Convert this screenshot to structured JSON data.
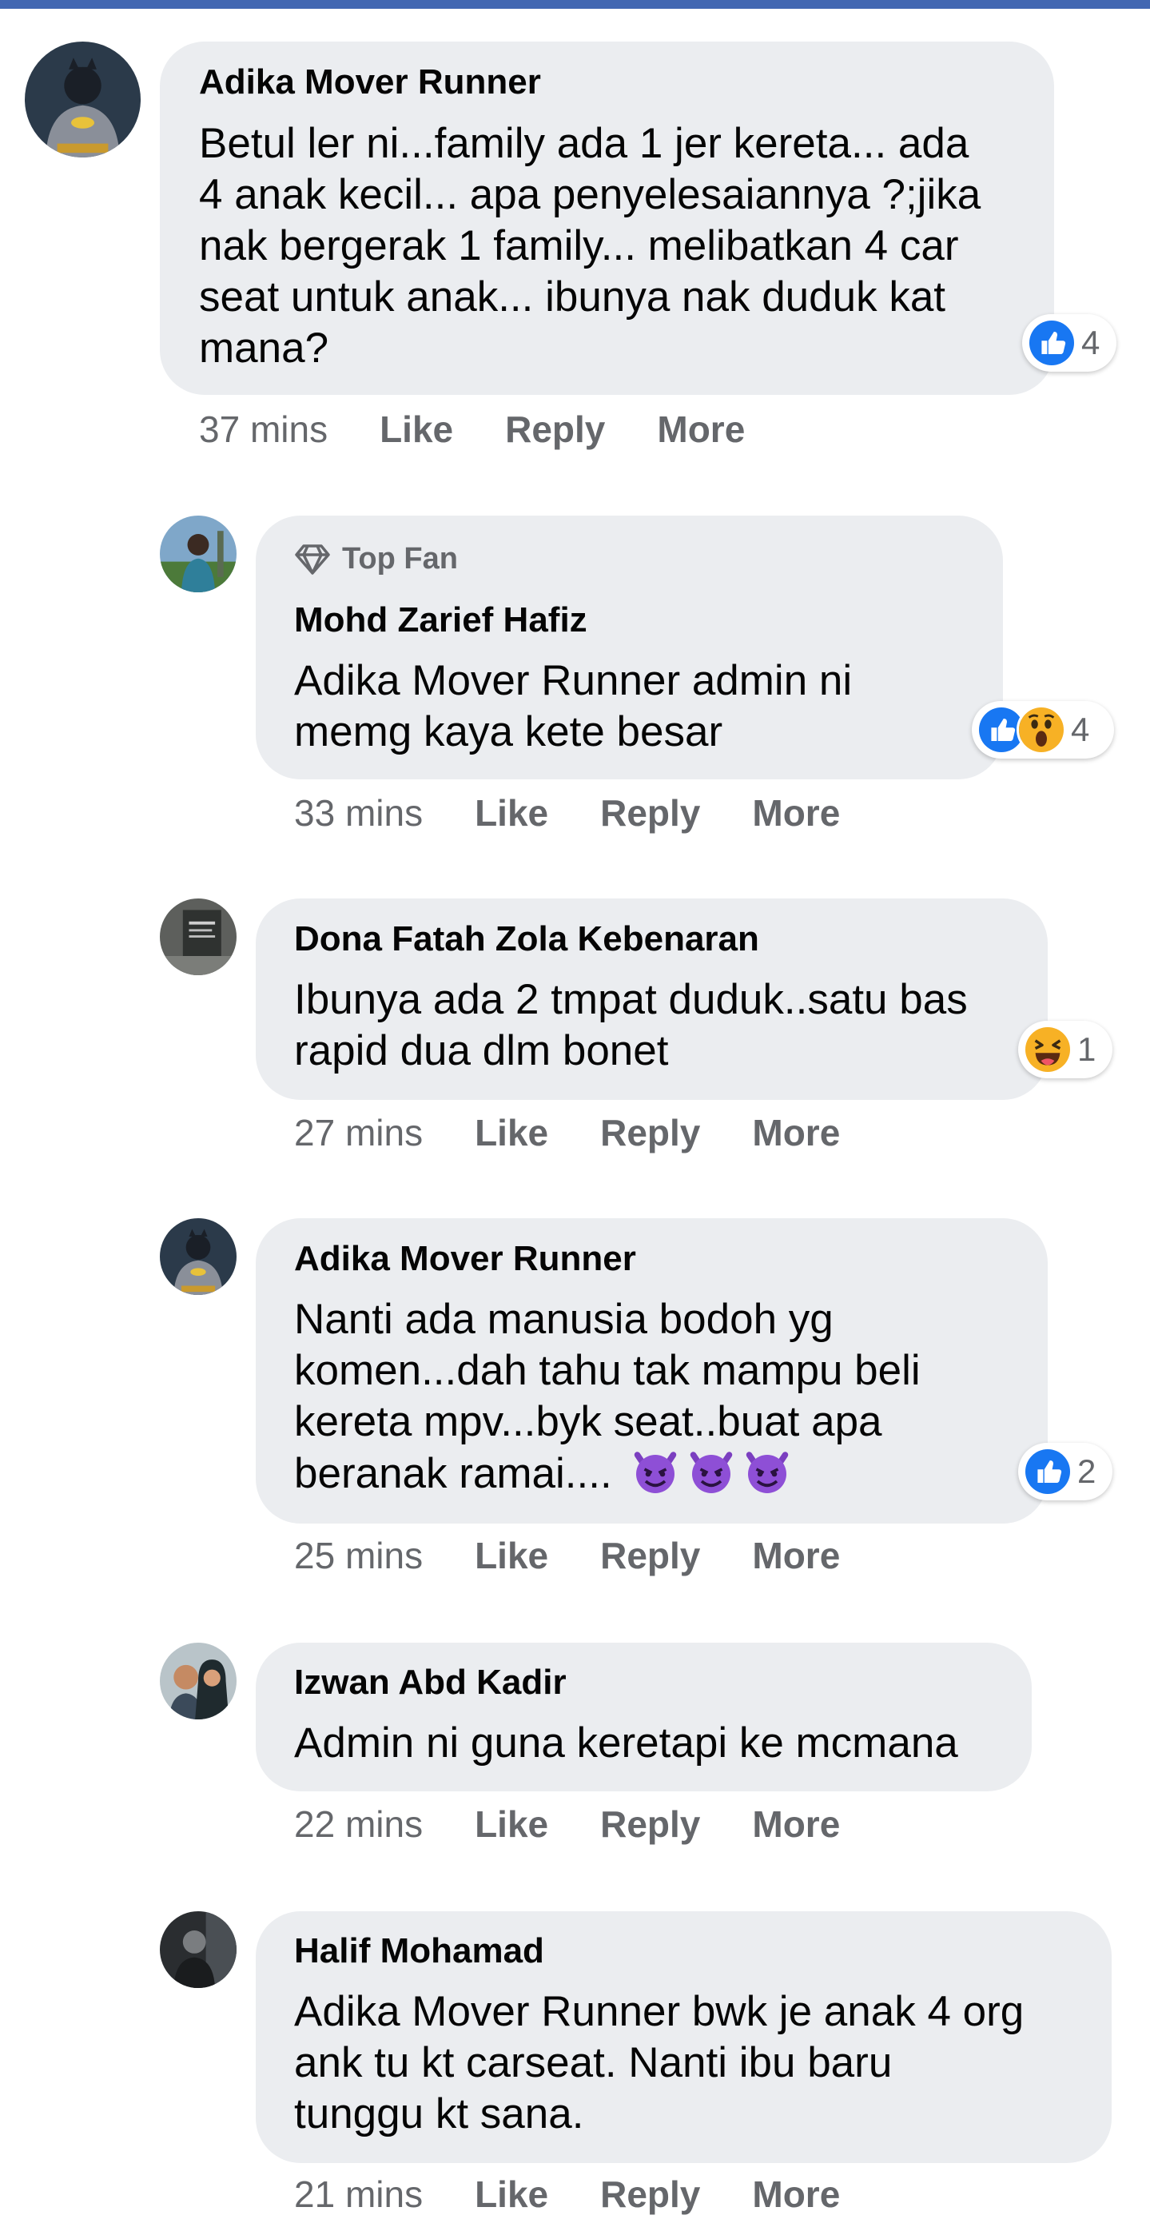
{
  "comments": [
    {
      "name": "Adika Mover Runner",
      "lines": [
        "Betul ler ni...family ada 1 jer kereta... ada",
        "4 anak kecil... apa penyelesaiannya ?;jika",
        "nak bergerak 1 family... melibatkan 4 car",
        "seat untuk anak... ibunya nak duduk kat",
        "mana?"
      ],
      "reaction_count": "4",
      "reactions": [
        "like-icon"
      ],
      "time": "37 mins",
      "like": "Like",
      "reply": "Reply",
      "more": "More"
    },
    {
      "badge": "Top Fan",
      "name": "Mohd Zarief Hafiz",
      "lines": [
        "Adika Mover Runner admin ni",
        "memg kaya kete besar"
      ],
      "reaction_count": "4",
      "reactions": [
        "like-icon",
        "wow-icon"
      ],
      "time": "33 mins",
      "like": "Like",
      "reply": "Reply",
      "more": "More"
    },
    {
      "name": "Dona Fatah Zola Kebenaran",
      "lines": [
        "Ibunya ada 2 tmpat duduk..satu bas",
        "rapid dua dlm bonet"
      ],
      "reaction_count": "1",
      "reactions": [
        "haha-icon"
      ],
      "time": "27 mins",
      "like": "Like",
      "reply": "Reply",
      "more": "More"
    },
    {
      "name": "Adika Mover Runner",
      "lines": [
        "Nanti ada manusia bodoh yg",
        "komen...dah tahu tak mampu beli",
        "kereta mpv...byk seat..buat apa",
        "beranak ramai...."
      ],
      "emojis": [
        "devil-emoji",
        "devil-emoji",
        "devil-emoji"
      ],
      "reaction_count": "2",
      "reactions": [
        "like-icon"
      ],
      "time": "25 mins",
      "like": "Like",
      "reply": "Reply",
      "more": "More"
    },
    {
      "name": "Izwan Abd Kadir",
      "lines": [
        "Admin ni guna keretapi ke mcmana"
      ],
      "time": "22 mins",
      "like": "Like",
      "reply": "Reply",
      "more": "More"
    },
    {
      "name": "Halif Mohamad",
      "lines": [
        "Adika Mover Runner bwk je anak 4 org",
        "ank tu kt carseat. Nanti ibu baru",
        "tunggu kt sana."
      ],
      "time": "21 mins",
      "like": "Like",
      "reply": "Reply",
      "more": "More"
    }
  ],
  "colors": {
    "header": "#4267b2",
    "bubble": "#ebedf0",
    "like_blue": "#1877f2",
    "meta_gray": "#65676b"
  }
}
